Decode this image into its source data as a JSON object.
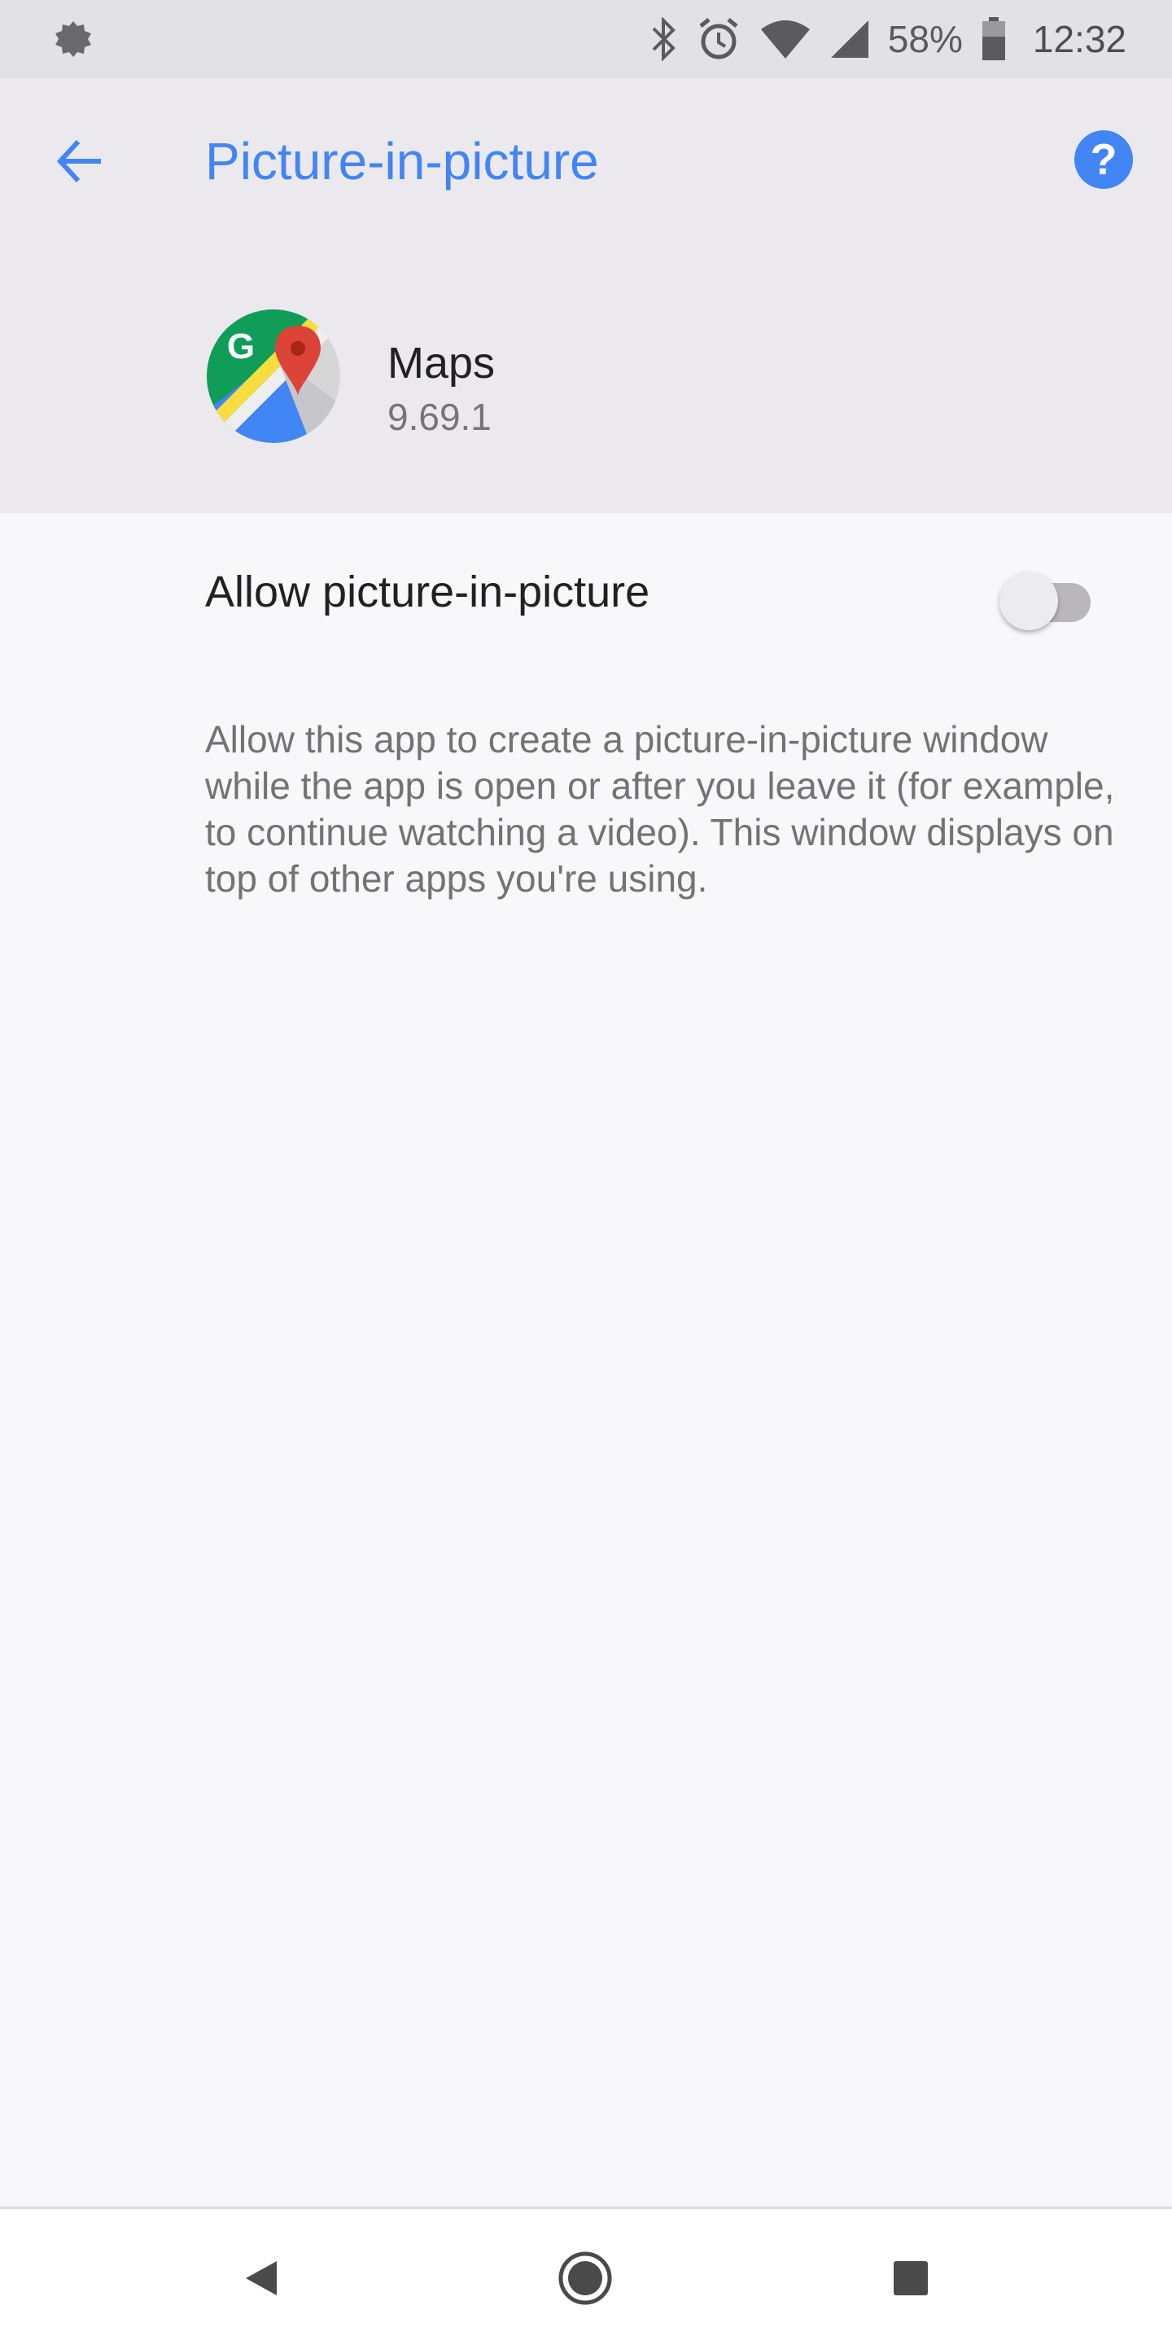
{
  "status_bar": {
    "battery_percent": "58%",
    "time": "12:32",
    "icons": [
      "settings-gear-icon",
      "bluetooth-icon",
      "alarm-icon",
      "wifi-icon",
      "cellular-signal-icon",
      "battery-icon"
    ]
  },
  "header": {
    "title": "Picture-in-picture",
    "back_icon": "arrow-back-icon",
    "help_icon": "help-icon"
  },
  "app": {
    "name": "Maps",
    "version": "9.69.1",
    "icon": "google-maps-icon"
  },
  "setting": {
    "label": "Allow picture-in-picture",
    "enabled": false,
    "description": "Allow this app to create a picture-in-picture window while the app is open or after you leave it (for example, to continue watching a video). This window displays on top of other apps you're using."
  },
  "nav_bar": {
    "icons": [
      "back-triangle-icon",
      "home-circle-icon",
      "recents-square-icon"
    ]
  },
  "colors": {
    "accent": "#4285f4",
    "header_bg": "#ebe9ee",
    "status_bg": "#e2e1e5",
    "content_bg": "#f8f7fa"
  }
}
